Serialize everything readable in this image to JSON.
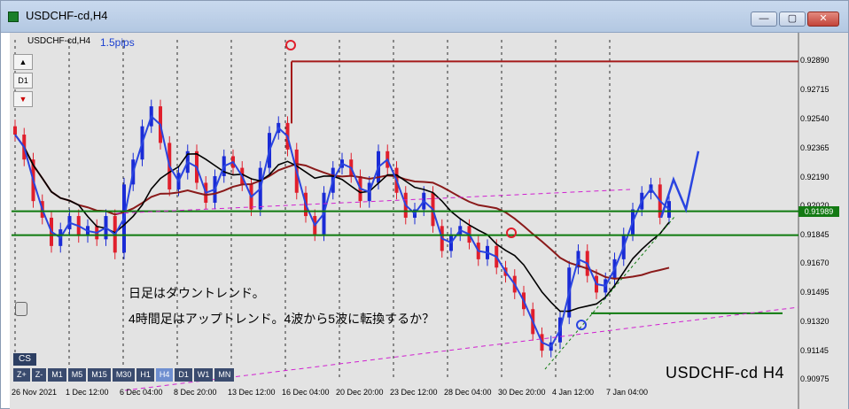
{
  "window": {
    "title": "USDCHF-cd,H4",
    "min_glyph": "—",
    "max_glyph": "▢",
    "close_glyph": "✕"
  },
  "chart_header": {
    "symbol": "USDCHF-cd,H4",
    "spread": "1.5pips"
  },
  "toolbar": {
    "up_glyph": "▲",
    "timeframe_d1": "D1",
    "down_glyph": "▼"
  },
  "annotations": {
    "line1": "日足はダウントレンド。",
    "line2": "4時間足はアップトレンド。4波から5波に転換するか？",
    "watermark": "USDCHF-cd H4"
  },
  "periods": {
    "cs": "CS",
    "buttons": [
      "Z+",
      "Z-",
      "M1",
      "M5",
      "M15",
      "M30",
      "H1",
      "H4",
      "D1",
      "W1",
      "MN"
    ],
    "active": "H4"
  },
  "current_price": "0.91989",
  "colors": {
    "background": "#e3e3e3",
    "bull_candle": "#1a2bd6",
    "bear_candle": "#e01f2c",
    "ma_fast": "#2a45e0",
    "ma_slow": "#000000",
    "ma_long": "#8a1a1a",
    "horizontal_lines": "#0e7a0e",
    "resistance_line": "#a51a1a",
    "marker": "#e01f2c",
    "marker_blue": "#2a45e0",
    "trendline_dashed": "#d020d0"
  },
  "chart_data": {
    "type": "candlestick",
    "title": "USDCHF-cd,H4",
    "y_axis_ticks": [
      "0.92890",
      "0.92715",
      "0.92540",
      "0.92365",
      "0.92190",
      "0.92020",
      "0.91845",
      "0.91670",
      "0.91495",
      "0.91320",
      "0.91145",
      "0.90975"
    ],
    "ylim": [
      0.90975,
      0.9302
    ],
    "x_axis_ticks": [
      "26 Nov 2021",
      "1 Dec 12:00",
      "6 Dec 04:00",
      "8 Dec 20:00",
      "13 Dec 12:00",
      "16 Dec 04:00",
      "20 Dec 20:00",
      "23 Dec 12:00",
      "28 Dec 04:00",
      "30 Dec 20:00",
      "4 Jan 12:00",
      "7 Jan 04:00"
    ],
    "close_series": [
      0.9245,
      0.923,
      0.9205,
      0.9195,
      0.9178,
      0.9188,
      0.9196,
      0.9184,
      0.919,
      0.9182,
      0.9196,
      0.9174,
      0.9215,
      0.923,
      0.925,
      0.9262,
      0.924,
      0.9212,
      0.9222,
      0.9235,
      0.9216,
      0.9204,
      0.922,
      0.9232,
      0.9225,
      0.9215,
      0.92,
      0.9225,
      0.9246,
      0.9252,
      0.9236,
      0.921,
      0.9196,
      0.9185,
      0.921,
      0.9225,
      0.923,
      0.922,
      0.9205,
      0.9216,
      0.9235,
      0.9225,
      0.921,
      0.9195,
      0.92,
      0.921,
      0.919,
      0.9175,
      0.9185,
      0.919,
      0.918,
      0.917,
      0.9178,
      0.9165,
      0.916,
      0.915,
      0.914,
      0.9125,
      0.9115,
      0.912,
      0.9135,
      0.9165,
      0.9175,
      0.916,
      0.915,
      0.9158,
      0.917,
      0.9185,
      0.92,
      0.921,
      0.9215,
      0.9195,
      0.9205
    ],
    "horizontal_levels": [
      0.9289,
      0.91989,
      0.91845,
      0.91375
    ],
    "projection": [
      0.9195,
      0.9218,
      0.92,
      0.9235
    ]
  }
}
